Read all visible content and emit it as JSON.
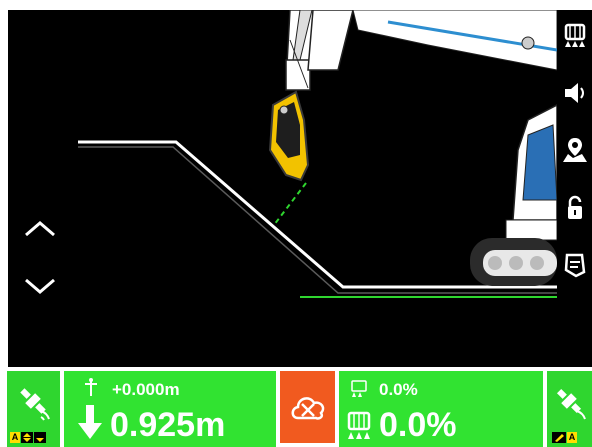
{
  "side_toolbar": {
    "items": [
      {
        "name": "bucket-teeth-icon"
      },
      {
        "name": "speaker-icon"
      },
      {
        "name": "map-pin-icon"
      },
      {
        "name": "lock-icon"
      },
      {
        "name": "bucket-icon"
      }
    ]
  },
  "view_controls": {
    "up": "chevron-up-icon",
    "down": "chevron-down-icon"
  },
  "status_bar": {
    "left_gps": {
      "icon": "satellite-icon",
      "mode_label": "A"
    },
    "depth": {
      "offset": "+0.000m",
      "value": "0.925m",
      "direction": "down"
    },
    "cloud": {
      "icon": "cloud-cancel-icon",
      "color": "#f15a1f"
    },
    "slope": {
      "target": "0.0%",
      "value": "0.0%"
    },
    "right_gps": {
      "icon": "satellite-icon",
      "mode_label": "A"
    }
  },
  "colors": {
    "panel_green": "#31e331",
    "design_line": "#ffffff",
    "surface_line": "#2fd62f",
    "bucket": "#f2c200"
  }
}
